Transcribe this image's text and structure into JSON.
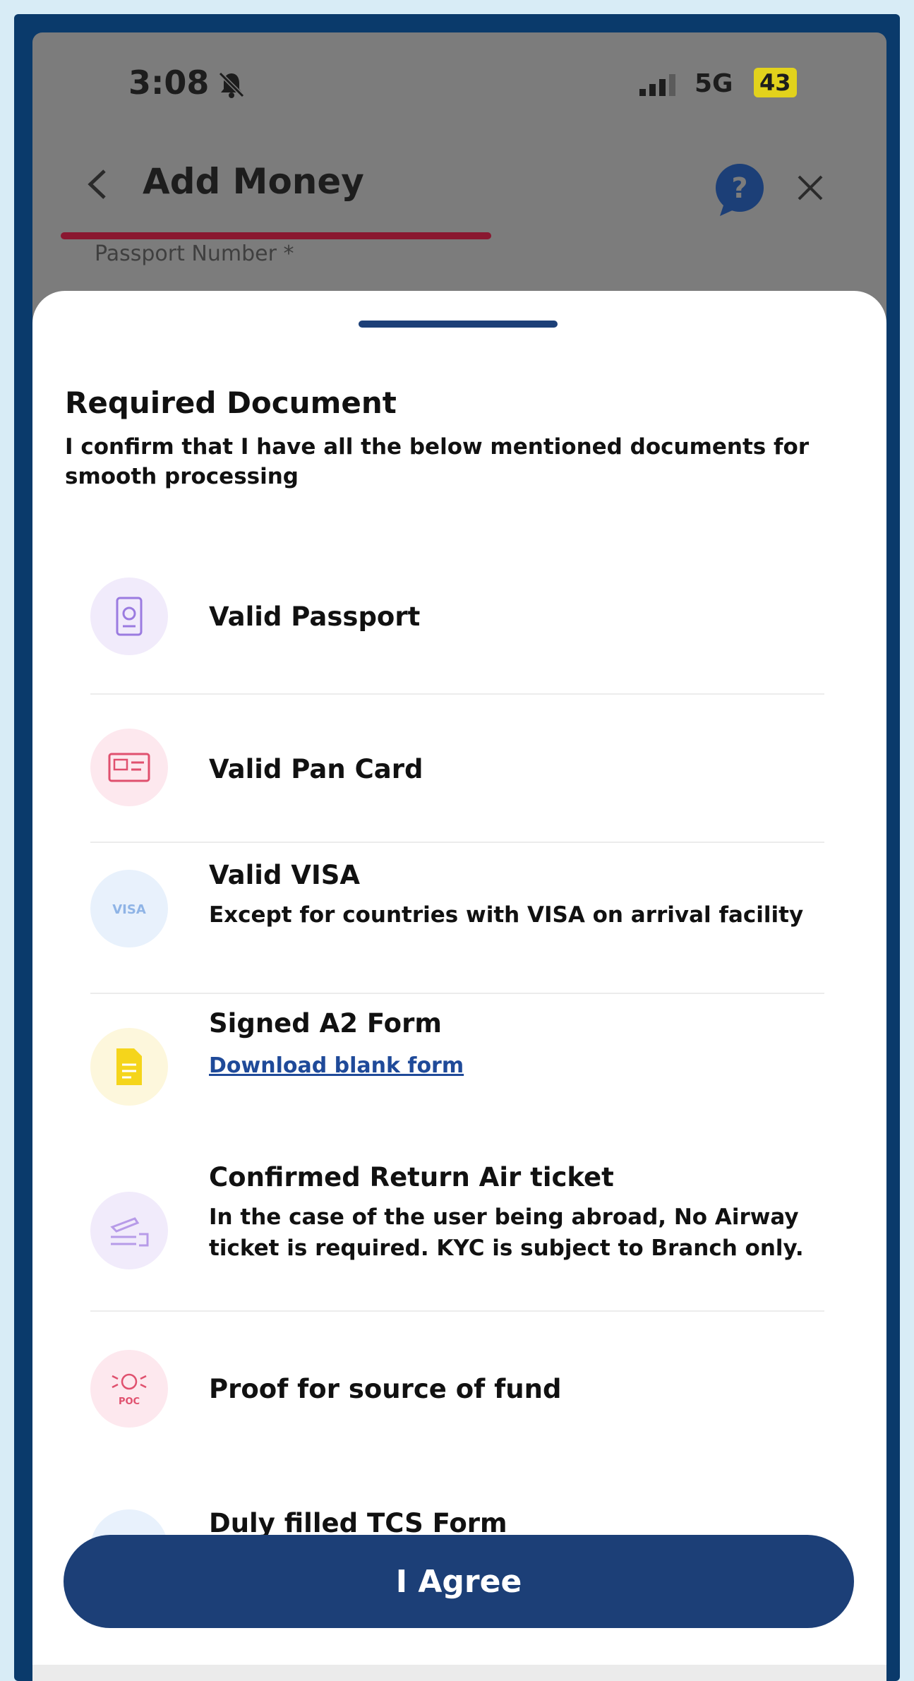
{
  "status_bar": {
    "time": "3:08",
    "network": "5G",
    "battery": "43"
  },
  "header": {
    "title": "Add Money",
    "behind_field_label": "Passport Number *"
  },
  "sheet": {
    "title": "Required Document",
    "subtitle": "I confirm that I have all the below mentioned documents for smooth processing",
    "items": [
      {
        "title": "Valid Passport",
        "icon": "passport-icon"
      },
      {
        "title": "Valid Pan Card",
        "icon": "id-card-icon"
      },
      {
        "title": "Valid VISA",
        "description": "Except for countries with VISA on arrival facility",
        "icon": "visa-icon"
      },
      {
        "title": "Signed A2 Form",
        "link": "Download blank form",
        "icon": "form-document-icon"
      },
      {
        "title": "Confirmed Return Air ticket",
        "description": "In the case of the user being abroad, No Airway ticket is required. KYC is subject to Branch only.",
        "icon": "air-ticket-icon"
      },
      {
        "title": "Proof for source of fund",
        "icon": "source-of-fund-icon"
      },
      {
        "title": "Duly filled TCS Form",
        "icon": "tcs-form-icon"
      }
    ],
    "agree_label": "I Agree"
  },
  "colors": {
    "primary": "#1c3f77",
    "progress": "#8a1730",
    "link": "#1f4a99"
  }
}
